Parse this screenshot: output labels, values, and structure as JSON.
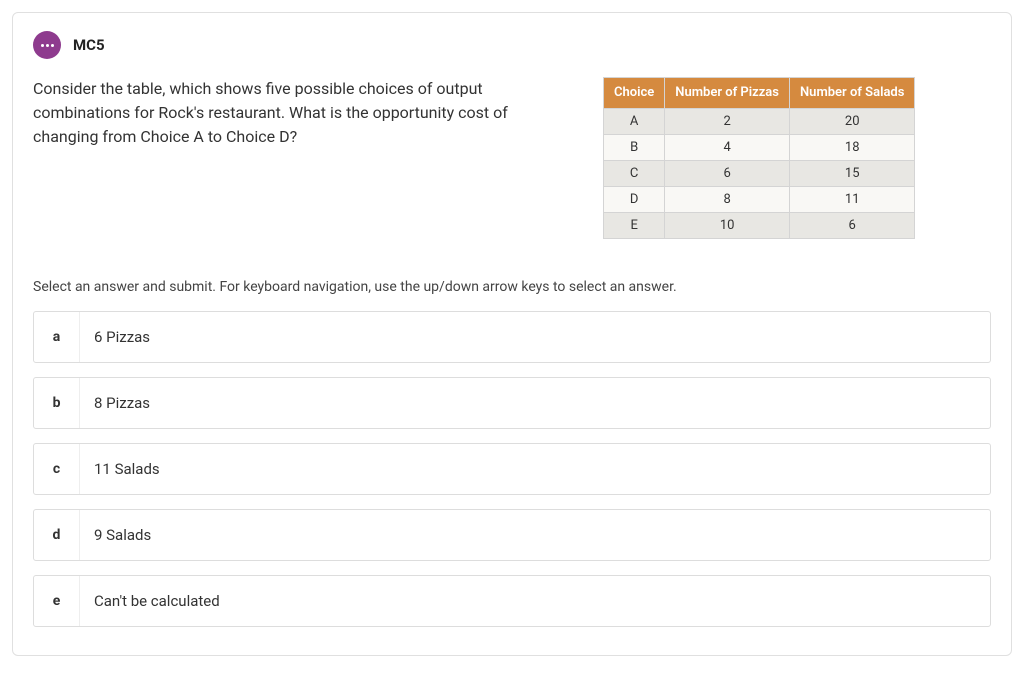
{
  "header": {
    "question_id": "MC5"
  },
  "question": {
    "text": "Consider the table, which shows five possible choices of output combinations for Rock's restaurant. What is the opportunity cost of changing from Choice A to Choice D?"
  },
  "table": {
    "headers": [
      "Choice",
      "Number of Pizzas",
      "Number of Salads"
    ],
    "rows": [
      [
        "A",
        "2",
        "20"
      ],
      [
        "B",
        "4",
        "18"
      ],
      [
        "C",
        "6",
        "15"
      ],
      [
        "D",
        "8",
        "11"
      ],
      [
        "E",
        "10",
        "6"
      ]
    ]
  },
  "instruction": "Select an answer and submit. For keyboard navigation, use the up/down arrow keys to select an answer.",
  "answers": [
    {
      "letter": "a",
      "text": "6 Pizzas"
    },
    {
      "letter": "b",
      "text": "8 Pizzas"
    },
    {
      "letter": "c",
      "text": "11 Salads"
    },
    {
      "letter": "d",
      "text": "9 Salads"
    },
    {
      "letter": "e",
      "text": "Can't be calculated"
    }
  ]
}
